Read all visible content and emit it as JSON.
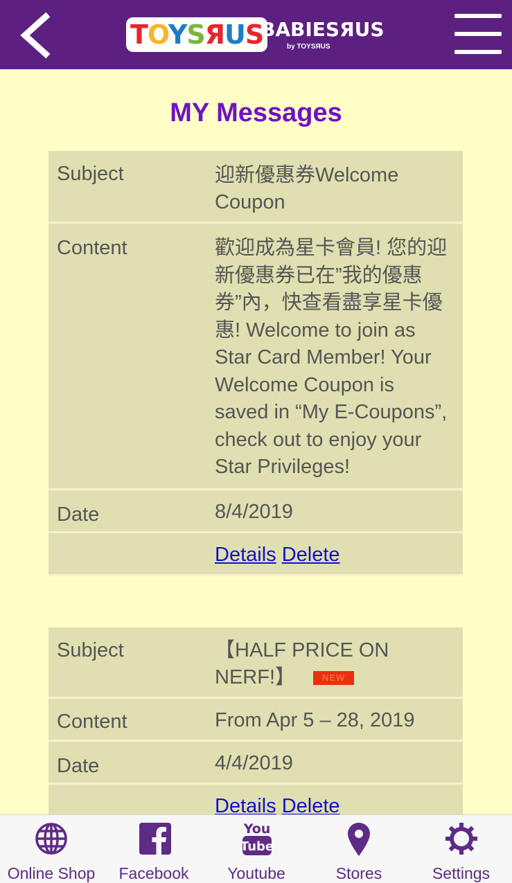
{
  "header": {
    "logo_toys_text": "TOYS R US",
    "logo_babies_text": "BABIES R US",
    "logo_babies_sub": "by TOYS R US"
  },
  "page_title": "MY Messages",
  "messages": [
    {
      "subject_label": "Subject",
      "subject": "迎新優惠券Welcome Coupon",
      "content_label": "Content",
      "content": "歡迎成為星卡會員! 您的迎新優惠券已在”我的優惠券”內，快查看盡享星卡優惠! Welcome to join as Star Card Member! Your Welcome Coupon is saved in “My E-Coupons”, check out to enjoy your Star Privileges!",
      "date_label": "Date",
      "date": "8/4/2019",
      "details_link": "Details",
      "delete_link": "Delete"
    },
    {
      "subject_label": "Subject",
      "subject": "【HALF PRICE ON NERF!】",
      "badge": "NEW",
      "content_label": "Content",
      "content": "From Apr 5 – 28, 2019",
      "date_label": "Date",
      "date": "4/4/2019",
      "details_link": "Details",
      "delete_link": "Delete"
    }
  ],
  "tabbar": {
    "items": [
      {
        "label": "Online Shop",
        "icon": "globe-icon"
      },
      {
        "label": "Facebook",
        "icon": "facebook-icon"
      },
      {
        "label": "Youtube",
        "icon": "youtube-icon"
      },
      {
        "label": "Stores",
        "icon": "map-pin-icon"
      },
      {
        "label": "Settings",
        "icon": "gear-icon"
      }
    ]
  },
  "colors": {
    "header_bg": "#5c2080",
    "page_bg": "#fefec6",
    "title": "#6f12c8",
    "row_bg": "#e0dfb1",
    "link": "#1111cc",
    "tab_icon": "#5e2b86"
  }
}
